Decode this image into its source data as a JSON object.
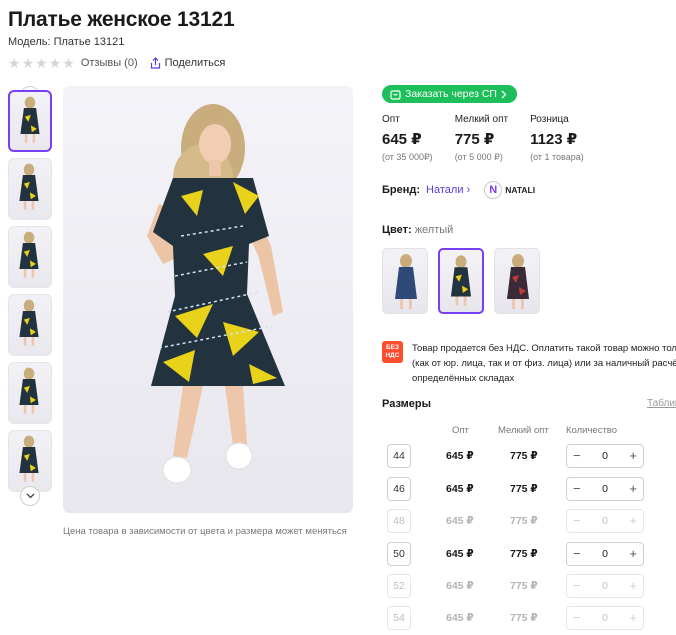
{
  "product": {
    "title": "Платье женское 13121",
    "model": "Модель: Платье 13121",
    "reviews": "Отзывы (0)",
    "share": "Поделиться"
  },
  "gallery": {
    "caption": "Цена товара в зависимости от цвета и размера может меняться",
    "thumb_count": 6,
    "active_thumb": 0
  },
  "order": {
    "sp_button": "Заказать через СП"
  },
  "prices": [
    {
      "label": "Опт",
      "value": "645 ₽",
      "note": "(от 35 000₽)"
    },
    {
      "label": "Мелкий опт",
      "value": "775 ₽",
      "note": "(от 5 000 ₽)"
    },
    {
      "label": "Розница",
      "value": "1123 ₽",
      "note": "(от 1 товара)"
    }
  ],
  "brand": {
    "label": "Бренд:",
    "name": "Натали",
    "logo_text": "NATALI"
  },
  "color": {
    "label": "Цвет:",
    "value": "желтый"
  },
  "vat": {
    "badge_line1": "БЕЗ",
    "badge_line2": "НДС",
    "line1": "Товар продается без НДС. Оплатить такой товар можно толь",
    "line2": "(как от юр. лица, так и от физ. лица) или за наличный расчёт",
    "line3": "определённых складах"
  },
  "sizes": {
    "title": "Размеры",
    "table_link": "Таблиц",
    "headers": {
      "opt": "Опт",
      "small": "Мелкий опт",
      "qty": "Количество"
    },
    "rows": [
      {
        "size": "44",
        "opt": "645 ₽",
        "small": "775 ₽",
        "qty": "0",
        "available": true
      },
      {
        "size": "46",
        "opt": "645 ₽",
        "small": "775 ₽",
        "qty": "0",
        "available": true
      },
      {
        "size": "48",
        "opt": "645 ₽",
        "small": "775 ₽",
        "qty": "0",
        "available": false
      },
      {
        "size": "50",
        "opt": "645 ₽",
        "small": "775 ₽",
        "qty": "0",
        "available": true
      },
      {
        "size": "52",
        "opt": "645 ₽",
        "small": "775 ₽",
        "qty": "0",
        "available": false
      },
      {
        "size": "54",
        "opt": "645 ₽",
        "small": "775 ₽",
        "qty": "0",
        "available": false
      }
    ]
  },
  "colors": {
    "accent": "#7b3ff2",
    "green": "#1dbf5a",
    "vat_badge": "#ff4d2d",
    "dress": "#22333f",
    "dress_yellow": "#e8d21a"
  }
}
